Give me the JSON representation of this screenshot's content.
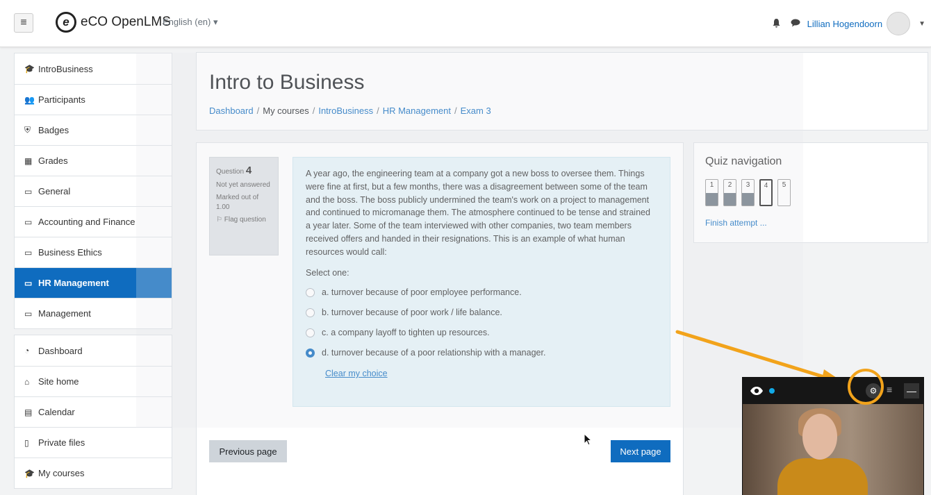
{
  "navbar": {
    "brand_logo": "e",
    "brand": "eCO OpenLMS",
    "language": "English (en) ▾",
    "user_name": "Lillian Hogendoorn"
  },
  "sidebar": {
    "course_items": [
      {
        "label": "IntroBusiness",
        "icon": "graduation-cap-icon"
      },
      {
        "label": "Participants",
        "icon": "users-icon"
      },
      {
        "label": "Badges",
        "icon": "shield-icon"
      },
      {
        "label": "Grades",
        "icon": "table-icon"
      },
      {
        "label": "General",
        "icon": "folder-icon"
      },
      {
        "label": "Accounting and Finance",
        "icon": "folder-icon"
      },
      {
        "label": "Business Ethics",
        "icon": "folder-icon"
      },
      {
        "label": "HR Management",
        "icon": "folder-icon",
        "active": true
      },
      {
        "label": "Management",
        "icon": "folder-icon"
      }
    ],
    "site_items": [
      {
        "label": "Dashboard",
        "icon": "dashboard-icon"
      },
      {
        "label": "Site home",
        "icon": "home-icon"
      },
      {
        "label": "Calendar",
        "icon": "calendar-icon"
      },
      {
        "label": "Private files",
        "icon": "file-icon"
      },
      {
        "label": "My courses",
        "icon": "graduation-cap-icon"
      }
    ]
  },
  "header": {
    "title": "Intro to Business",
    "breadcrumb": [
      "Dashboard",
      "My courses",
      "IntroBusiness",
      "HR Management",
      "Exam 3"
    ]
  },
  "question": {
    "number_label": "Question",
    "number": "4",
    "status": "Not yet answered",
    "marked_out_of": "Marked out of 1.00",
    "flag": "Flag question",
    "text": "A year ago, the engineering team at a company got a new boss to oversee them. Things were fine at first, but a few months, there was a disagreement between some of the team and the boss. The boss publicly undermined the team's work on a project to management and continued to micromanage them. The atmosphere continued to be tense and strained a year later. Some of the team interviewed with other companies, two team members received offers and handed in their resignations. This is an example of what human resources would call:",
    "select_label": "Select one:",
    "options": [
      {
        "label": "a. turnover because of poor employee performance.",
        "selected": false
      },
      {
        "label": "b. turnover because of poor work / life balance.",
        "selected": false
      },
      {
        "label": "c. a company layoff to tighten up resources.",
        "selected": false
      },
      {
        "label": "d. turnover because of a poor relationship with a manager.",
        "selected": true
      }
    ],
    "clear_choice": "Clear my choice"
  },
  "buttons": {
    "previous": "Previous page",
    "next": "Next page"
  },
  "quiz_nav": {
    "title": "Quiz navigation",
    "questions": [
      {
        "label": "1",
        "answered": true
      },
      {
        "label": "2",
        "answered": true
      },
      {
        "label": "3",
        "answered": true
      },
      {
        "label": "4",
        "answered": false,
        "current": true
      },
      {
        "label": "5",
        "answered": false
      }
    ],
    "finish": "Finish attempt ..."
  },
  "colors": {
    "primary": "#0f6cbf",
    "question_bg": "#e5f3f8",
    "annotation": "#f2a31b"
  }
}
